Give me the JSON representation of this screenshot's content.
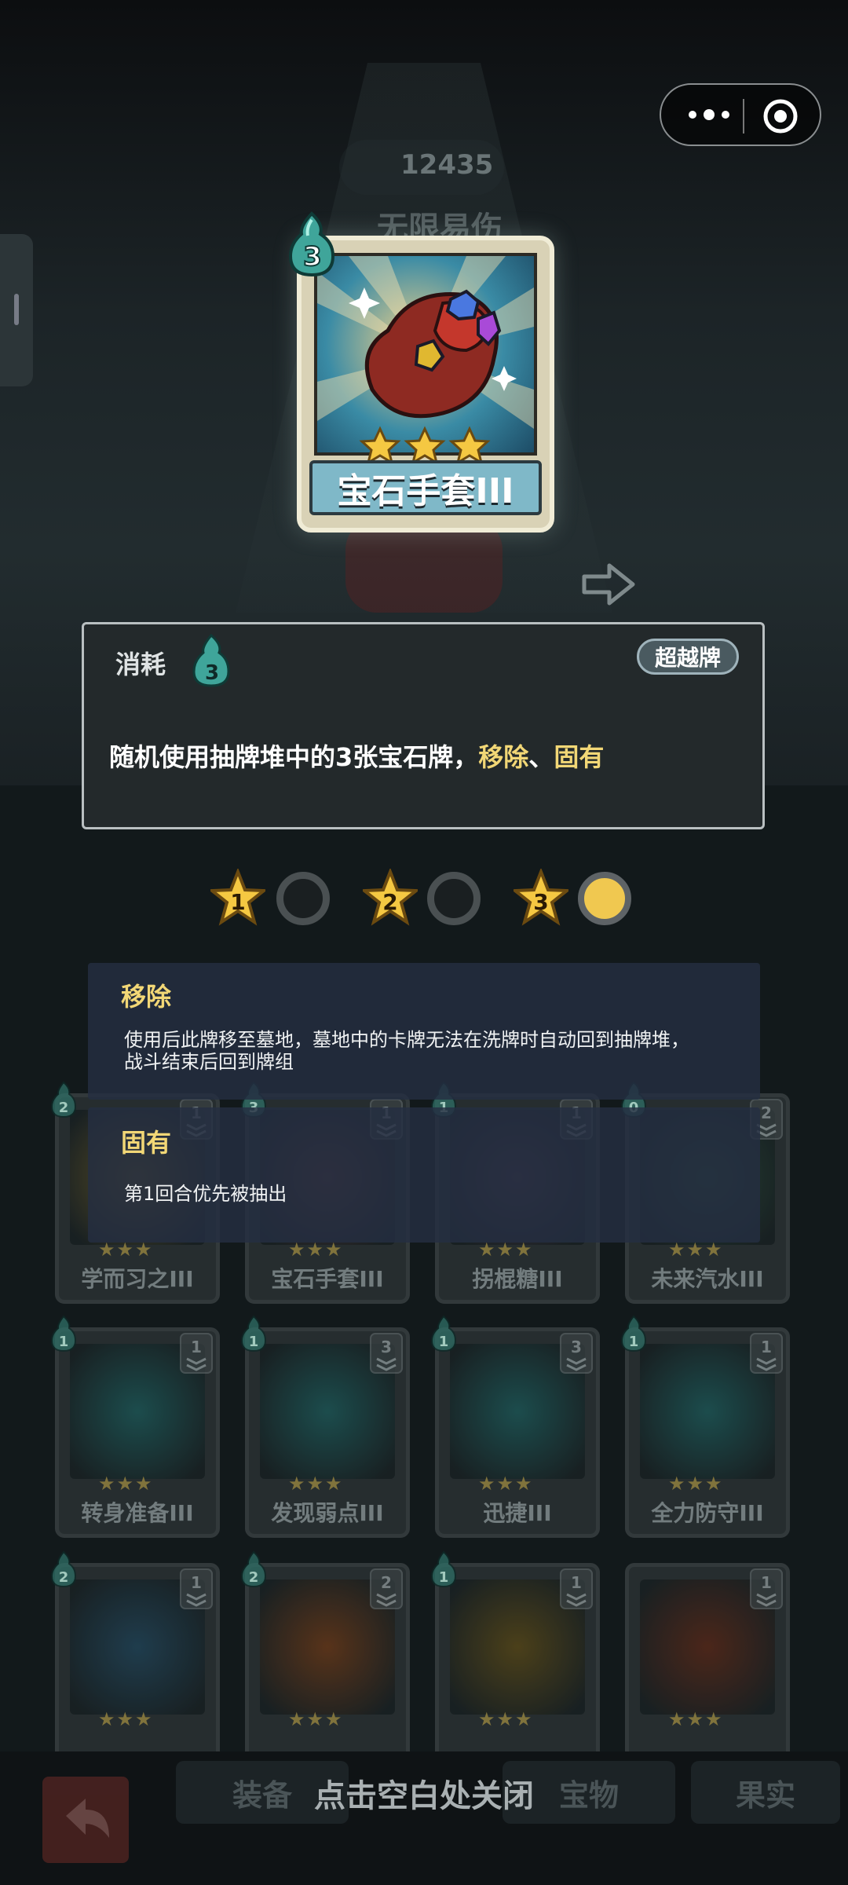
{
  "top_bar": {
    "currency_value": "12435",
    "buff_label": "无限易伤"
  },
  "card": {
    "name": "宝石手套III",
    "cost": "3",
    "star_count": 3
  },
  "description": {
    "cost_label": "消耗",
    "cost_value": "3",
    "tag": "超越牌",
    "text_prefix": "随机使用抽牌堆中的3张宝石牌，",
    "keyword1": "移除",
    "separator": "、",
    "keyword2": "固有"
  },
  "upgrades": [
    {
      "level": "1",
      "state": "empty"
    },
    {
      "level": "2",
      "state": "empty"
    },
    {
      "level": "3",
      "state": "filled"
    }
  ],
  "keywords": [
    {
      "title": "移除",
      "line1": "使用后此牌移至墓地，墓地中的卡牌无法在洗牌时自动回到抽牌堆，",
      "line2": "战斗结束后回到牌组"
    },
    {
      "title": "固有",
      "line1": "第1回合优先被抽出",
      "line2": ""
    }
  ],
  "deck_rows": [
    [
      {
        "name": "学而习之III",
        "cost": "2",
        "count": "1",
        "color": "#6a5a2a"
      },
      {
        "name": "宝石手套III",
        "cost": "3",
        "count": "1",
        "color": "#5a3a3a"
      },
      {
        "name": "拐棍糖III",
        "cost": "1",
        "count": "1",
        "color": "#4a3a4a"
      },
      {
        "name": "未来汽水III",
        "cost": "0",
        "count": "2",
        "color": "#2a4a3a"
      }
    ],
    [
      {
        "name": "转身准备III",
        "cost": "1",
        "count": "1",
        "color": "#1f5a5a"
      },
      {
        "name": "发现弱点III",
        "cost": "1",
        "count": "3",
        "color": "#1f5a5a"
      },
      {
        "name": "迅捷III",
        "cost": "1",
        "count": "3",
        "color": "#1f5a5a"
      },
      {
        "name": "全力防守III",
        "cost": "1",
        "count": "1",
        "color": "#1f5a5a"
      }
    ],
    [
      {
        "name": "",
        "cost": "2",
        "count": "1",
        "color": "#23465a"
      },
      {
        "name": "",
        "cost": "2",
        "count": "2",
        "color": "#6a3a1a"
      },
      {
        "name": "",
        "cost": "1",
        "count": "1",
        "color": "#5a4a1a"
      },
      {
        "name": "",
        "cost": "",
        "count": "1",
        "color": "#5a2a1a"
      }
    ]
  ],
  "bottom": {
    "tabs": [
      "装备",
      "宝物",
      "果实"
    ],
    "close_hint": "点击空白处关闭"
  }
}
